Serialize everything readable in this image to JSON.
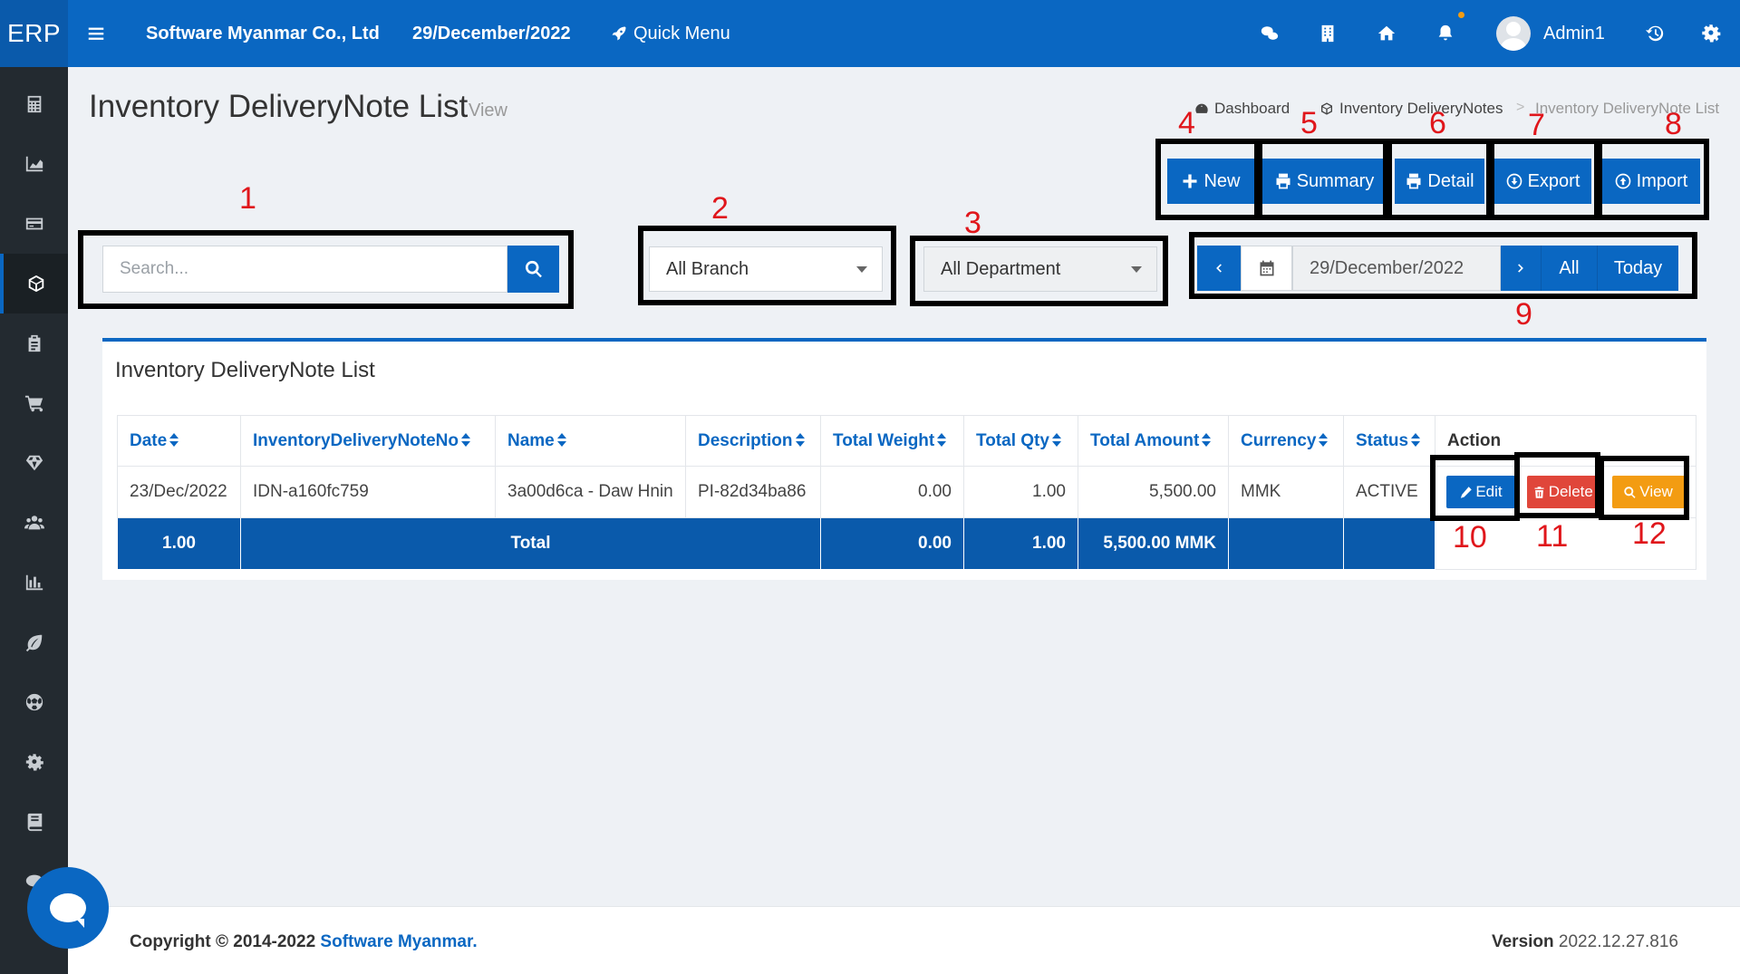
{
  "topbar": {
    "brand": "ERP",
    "company": "Software Myanmar Co., Ltd",
    "date": "29/December/2022",
    "quick_menu": "Quick Menu",
    "user": "Admin1"
  },
  "sidebar": {
    "icons": [
      "calculator-icon",
      "area-chart-icon",
      "credit-card-icon",
      "cube-icon",
      "clipboard-icon",
      "cart-icon",
      "diamond-icon",
      "users-icon",
      "bar-chart-icon",
      "leaf-icon",
      "soccer-ball-icon",
      "gear-icon",
      "book-icon",
      "comment-icon"
    ],
    "active_index": 3
  },
  "header": {
    "title": "Inventory DeliveryNote List",
    "subtitle": "View",
    "breadcrumb": {
      "dashboard": "Dashboard",
      "notes": "Inventory DeliveryNotes",
      "current": "Inventory DeliveryNote List",
      "separator": ">"
    }
  },
  "toolbar": {
    "new": "New",
    "summary": "Summary",
    "detail": "Detail",
    "export": "Export",
    "import": "Import"
  },
  "filters": {
    "search_placeholder": "Search...",
    "branch": "All Branch",
    "department": "All Department",
    "date": "29/December/2022",
    "all": "All",
    "today": "Today"
  },
  "annotations": [
    "1",
    "2",
    "3",
    "4",
    "5",
    "6",
    "7",
    "8",
    "9",
    "10",
    "11",
    "12"
  ],
  "card": {
    "title": "Inventory DeliveryNote List"
  },
  "table": {
    "headers": [
      "Date",
      "InventoryDeliveryNoteNo",
      "Name",
      "Description",
      "Total Weight",
      "Total Qty",
      "Total Amount",
      "Currency",
      "Status",
      "Action"
    ],
    "rows": [
      {
        "date": "23/Dec/2022",
        "no": "IDN-a160fc759",
        "name": "3a00d6ca - Daw Hnin",
        "description": "PI-82d34ba86",
        "weight": "0.00",
        "qty": "1.00",
        "amount": "5,500.00",
        "currency": "MMK",
        "status": "ACTIVE"
      }
    ],
    "actions": {
      "edit": "Edit",
      "delete": "Delete",
      "view": "View"
    },
    "total": {
      "count": "1.00",
      "label": "Total",
      "weight": "0.00",
      "qty": "1.00",
      "amount": "5,500.00 MMK"
    }
  },
  "footer": {
    "copyright": "Copyright © 2014-2022",
    "company_link": "Software Myanmar.",
    "version_label": "Version",
    "version": "2022.12.27.816"
  },
  "colors": {
    "primary": "#0a67c2",
    "sidebar": "#232a30",
    "delete": "#e0463a",
    "view": "#f39c12",
    "annotation": "#e0161b"
  }
}
